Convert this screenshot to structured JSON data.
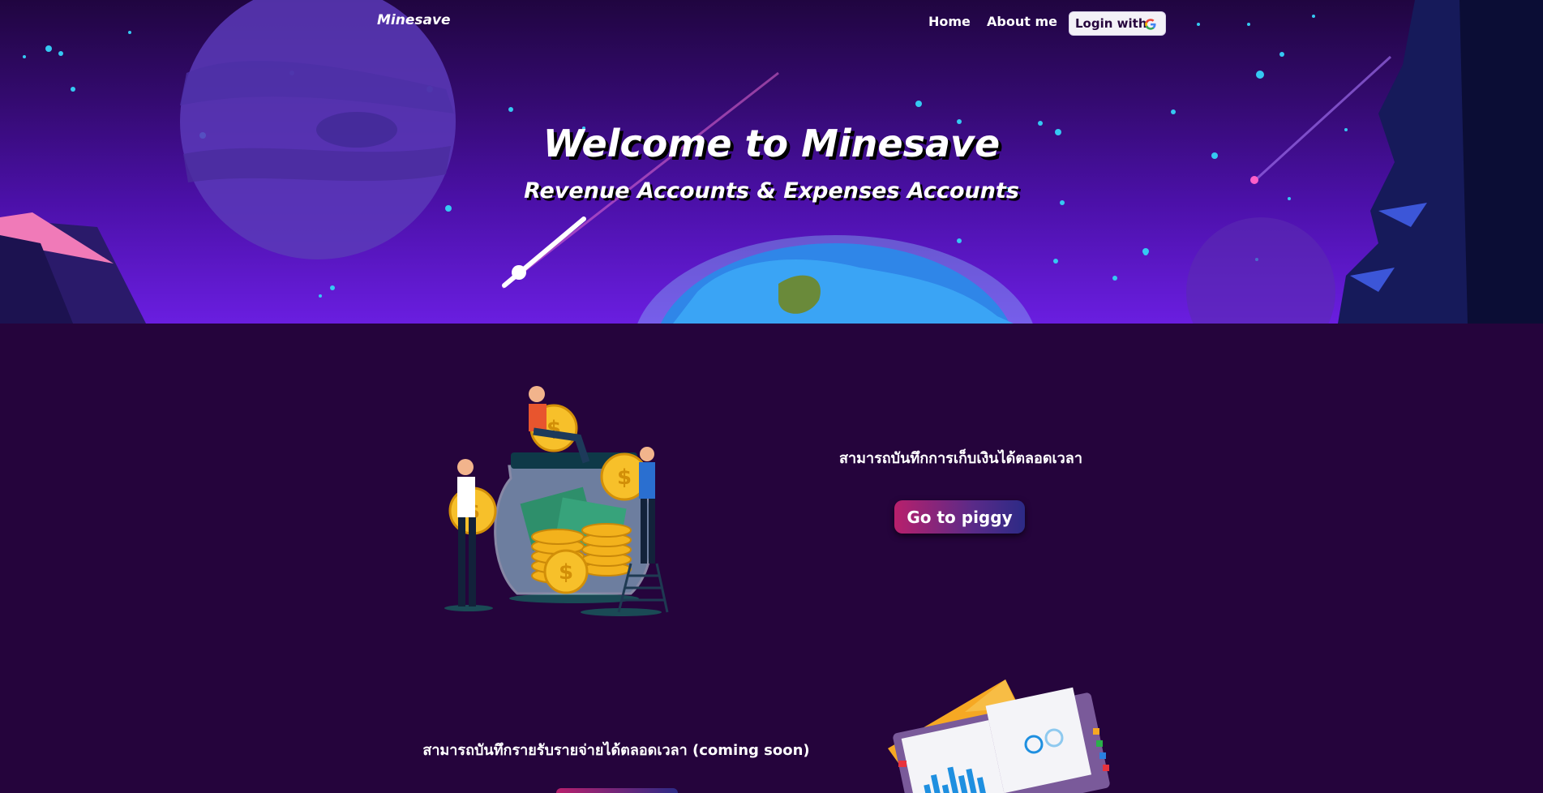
{
  "nav": {
    "brand": "Minesave",
    "links": [
      {
        "label": "Home"
      },
      {
        "label": "About me"
      }
    ],
    "login_label": "Login with",
    "login_icon": "google-icon"
  },
  "hero": {
    "title": "Welcome to Minesave",
    "subtitle": "Revenue Accounts & Expenses Accounts"
  },
  "sections": [
    {
      "text": "สามารถบันทึกการเก็บเงินได้ตลอดเวลา",
      "button_label": "Go to piggy",
      "illustration": "savings-jar-illustration"
    },
    {
      "text": "สามารถบันทึกรายรับรายจ่ายได้ตลอดเวลา (coming soon)",
      "illustration": "notebook-chart-illustration"
    }
  ],
  "colors": {
    "page_bg": "#25043c",
    "accent_pink": "#b8206c",
    "accent_blue": "#2c2a86",
    "star_cyan": "#31c8f0"
  }
}
